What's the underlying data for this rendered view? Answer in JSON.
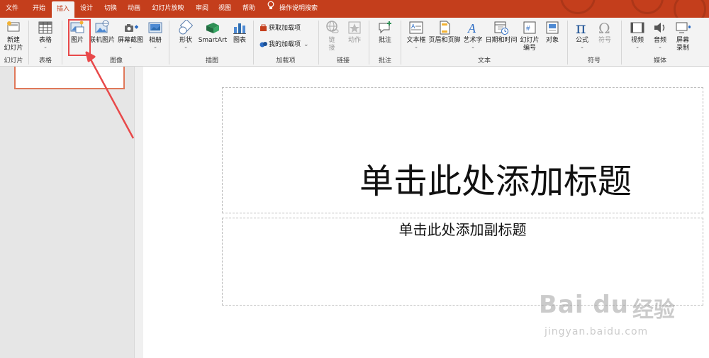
{
  "tabs": [
    "文件",
    "开始",
    "插入",
    "设计",
    "切换",
    "动画",
    "幻灯片放映",
    "审阅",
    "视图",
    "帮助"
  ],
  "active_tab": "插入",
  "tell_me": "操作说明搜索",
  "ribbon": {
    "slides": {
      "new_slide_line1": "新建",
      "new_slide_line2": "幻灯片",
      "group": "幻灯片"
    },
    "tables": {
      "table": "表格",
      "group": "表格"
    },
    "images": {
      "picture": "图片",
      "online_picture": "联机图片",
      "screenshot": "屏幕截图",
      "album": "相册",
      "group": "图像"
    },
    "illustrations": {
      "shapes": "形状",
      "smartart": "SmartArt",
      "chart": "图表",
      "group": "插图"
    },
    "addins": {
      "get_addins": "获取加载项",
      "my_addins": "我的加载项",
      "group": "加载项"
    },
    "links": {
      "link_line1": "链",
      "link_line2": "接",
      "action": "动作",
      "group": "链接"
    },
    "comments": {
      "comment": "批注",
      "group": "批注"
    },
    "text": {
      "textbox": "文本框",
      "header_footer": "页眉和页脚",
      "wordart": "艺术字",
      "datetime": "日期和时间",
      "slide_number_line1": "幻灯片",
      "slide_number_line2": "编号",
      "object": "对象",
      "group": "文本"
    },
    "symbols": {
      "equation": "公式",
      "symbol": "符号",
      "group": "符号"
    },
    "media": {
      "video": "视频",
      "audio": "音频",
      "screen_rec_line1": "屏幕",
      "screen_rec_line2": "录制",
      "group": "媒体"
    }
  },
  "slide": {
    "title_placeholder": "单击此处添加标题",
    "subtitle_placeholder": "单击此处添加副标题"
  },
  "watermark": {
    "logo": "Bai du",
    "cn": "经验",
    "url": "jingyan.baidu.com"
  },
  "colors": {
    "accent": "#c43e1c",
    "annotation": "#e8494a"
  },
  "icons": [
    "new-slide-icon",
    "table-icon",
    "picture-icon",
    "online-picture-icon",
    "screenshot-icon",
    "album-icon",
    "shapes-icon",
    "smartart-icon",
    "chart-icon",
    "store-icon",
    "addins-icon",
    "link-icon",
    "action-icon",
    "comment-icon",
    "textbox-icon",
    "header-footer-icon",
    "wordart-icon",
    "datetime-icon",
    "slide-number-icon",
    "object-icon",
    "equation-icon",
    "symbol-icon",
    "video-icon",
    "audio-icon",
    "screen-recording-icon",
    "lightbulb-icon"
  ]
}
